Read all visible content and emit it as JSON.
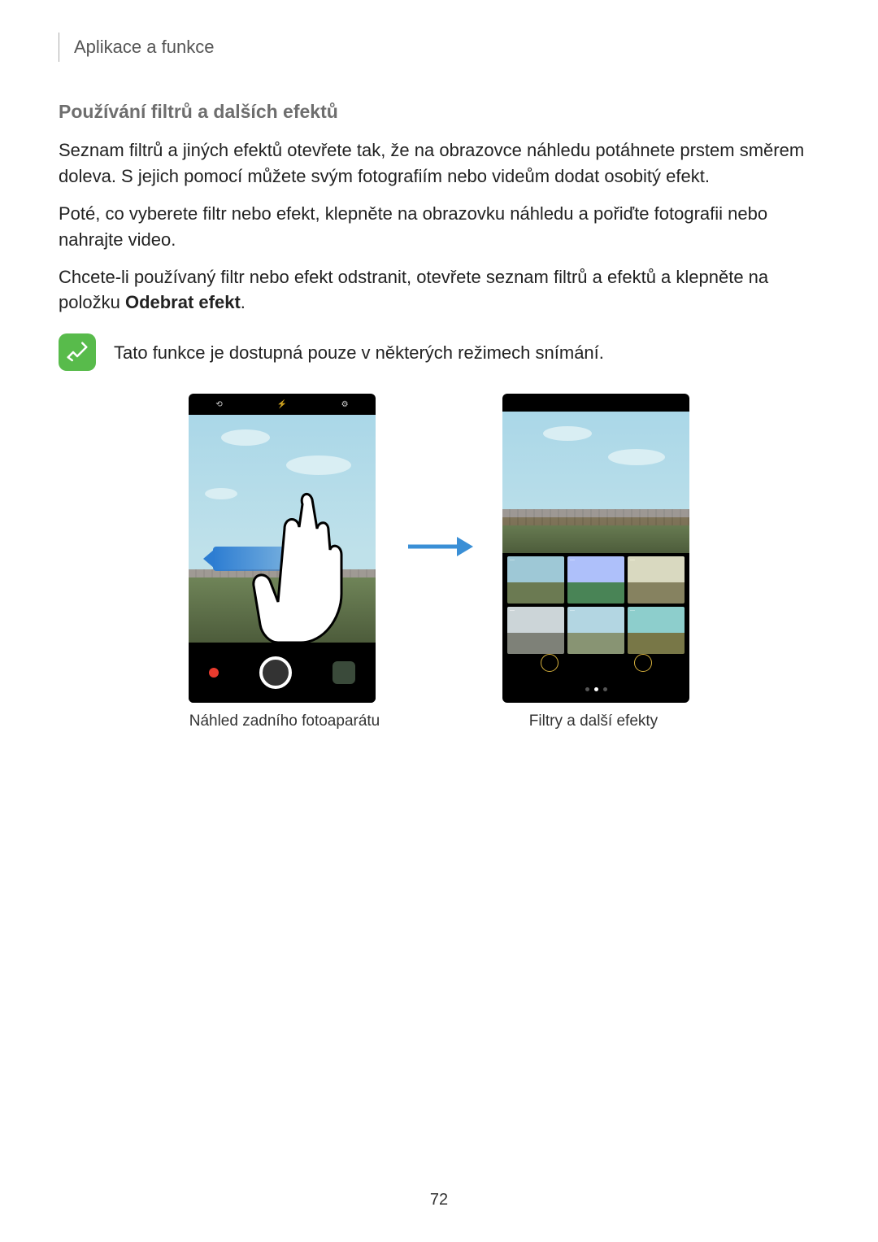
{
  "breadcrumb": "Aplikace a funkce",
  "section_title": "Používání filtrů a dalších efektů",
  "para1": "Seznam filtrů a jiných efektů otevřete tak, že na obrazovce náhledu potáhnete prstem směrem doleva. S jejich pomocí můžete svým fotografiím nebo videům dodat osobitý efekt.",
  "para2": "Poté, co vyberete filtr nebo efekt, klepněte na obrazovku náhledu a pořiďte fotografii nebo nahrajte video.",
  "para3_pre": "Chcete-li používaný filtr nebo efekt odstranit, otevřete seznam filtrů a efektů a klepněte na položku ",
  "para3_bold": "Odebrat efekt",
  "para3_post": ".",
  "note_text": "Tato funkce je dostupná pouze v některých režimech snímání.",
  "caption_left": "Náhled zadního fotoaparátu",
  "caption_right": "Filtry a další efekty",
  "page_number": "72"
}
